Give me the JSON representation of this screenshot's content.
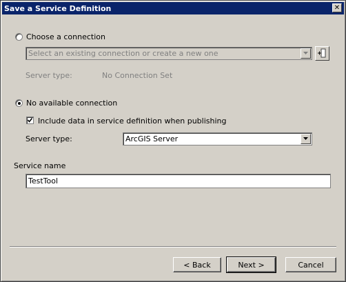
{
  "window": {
    "title": "Save a Service Definition",
    "close_symbol": "✕"
  },
  "choose_connection": {
    "label": "Choose a connection",
    "selected": false,
    "combo_text": "Select an existing connection or create a new one",
    "add_button_icon": "add-connection-icon",
    "server_type_label": "Server type:",
    "server_type_value": "No Connection Set"
  },
  "no_connection": {
    "label": "No available connection",
    "selected": true,
    "include_data_label": "Include data in service definition when publishing",
    "include_data_checked": true,
    "server_type_label": "Server type:",
    "server_type_value": "ArcGIS Server"
  },
  "service_name": {
    "label": "Service name",
    "value": "TestTool"
  },
  "buttons": {
    "back": "< Back",
    "next": "Next >",
    "cancel": "Cancel"
  }
}
